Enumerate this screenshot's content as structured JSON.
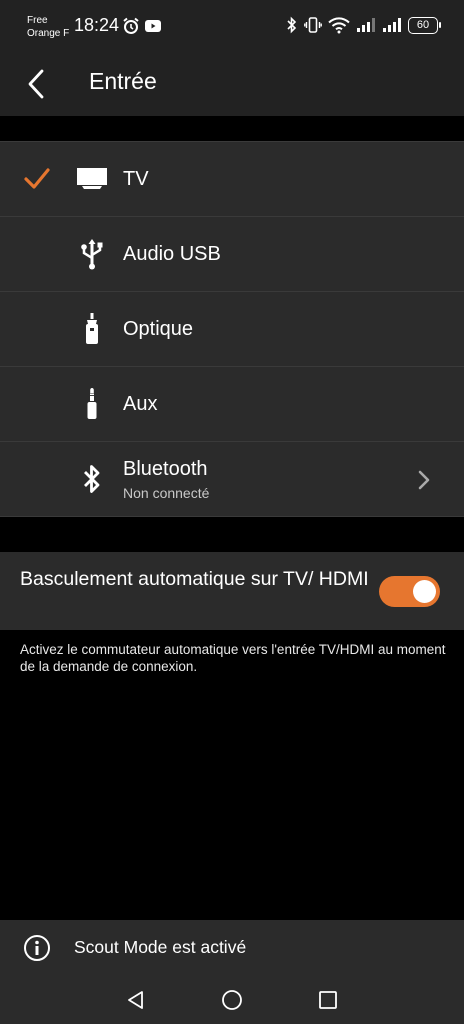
{
  "status_bar": {
    "carrier_line1": "Free",
    "carrier_line2": "Orange F",
    "time": "18:24",
    "battery": "60"
  },
  "header": {
    "title": "Entrée"
  },
  "inputs": [
    {
      "label": "TV",
      "selected": true,
      "icon": "tv-icon"
    },
    {
      "label": "Audio USB",
      "selected": false,
      "icon": "usb-icon"
    },
    {
      "label": "Optique",
      "selected": false,
      "icon": "optical-icon"
    },
    {
      "label": "Aux",
      "selected": false,
      "icon": "aux-jack-icon"
    },
    {
      "label": "Bluetooth",
      "sublabel": "Non connecté",
      "selected": false,
      "icon": "bluetooth-icon"
    }
  ],
  "auto_switch": {
    "label": "Basculement automatique sur TV/ HDMI",
    "enabled": true,
    "description": "Activez le commutateur automatique vers l'entrée TV/HDMI au moment de la demande de connexion."
  },
  "scout": {
    "text": "Scout Mode est activé"
  },
  "colors": {
    "accent": "#e6762f",
    "surface": "#2b2b2b",
    "bar": "#222222",
    "background": "#000000"
  }
}
